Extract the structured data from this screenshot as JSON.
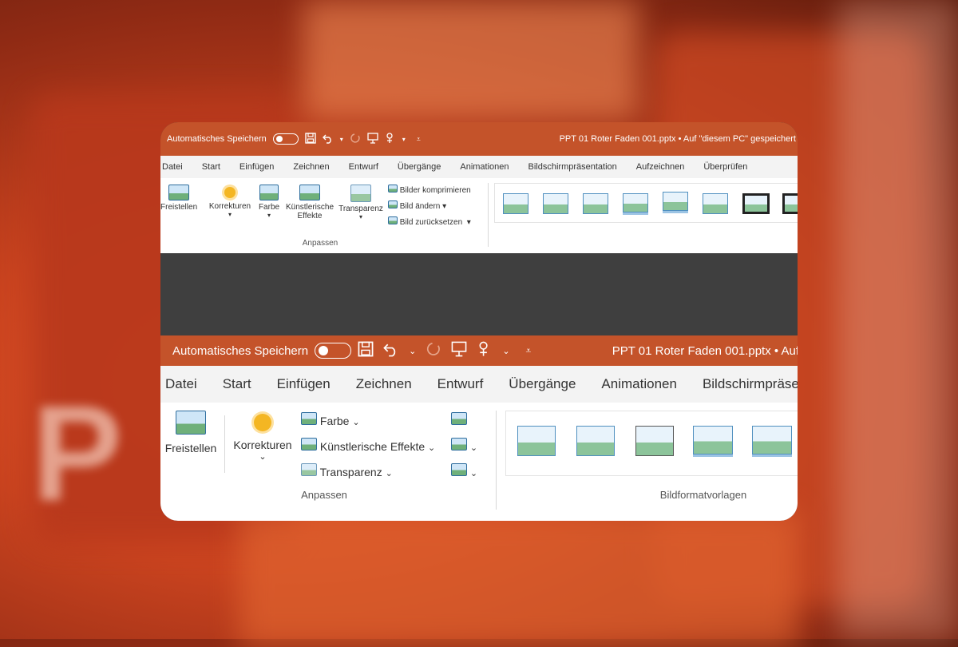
{
  "titlebar": {
    "autosave_label": "Automatisches Speichern",
    "filename_top": "PPT 01 Roter Faden 001.pptx • Auf \"diesem PC\" gespeichert",
    "filename_bottom": "PPT 01 Roter Faden 001.pptx • Auf",
    "qat_icons": [
      "save-icon",
      "undo-icon",
      "redo-icon",
      "present-icon",
      "touch-mode-icon",
      "customize-qat-icon"
    ]
  },
  "tabs_top": [
    "Datei",
    "Start",
    "Einfügen",
    "Zeichnen",
    "Entwurf",
    "Übergänge",
    "Animationen",
    "Bildschirmpräsentation",
    "Aufzeichnen",
    "Überprüfen"
  ],
  "tabs_bottom": [
    "Datei",
    "Start",
    "Einfügen",
    "Zeichnen",
    "Entwurf",
    "Übergänge",
    "Animationen",
    "Bildschirmpräse"
  ],
  "ribbon_top": {
    "freistellen": "Freistellen",
    "korrekturen": "Korrekturen",
    "farbe": "Farbe",
    "kuenstlerisch_1": "Künstlerische",
    "kuenstlerisch_2": "Effekte",
    "transparenz": "Transparenz",
    "komprimieren": "Bilder komprimieren",
    "aendern": "Bild ändern",
    "zuruecksetzen": "Bild zurücksetzen",
    "group_anpassen": "Anpassen"
  },
  "ribbon_bottom": {
    "freistellen": "Freistellen",
    "korrekturen": "Korrekturen",
    "farbe": "Farbe",
    "kuenstlerisch": "Künstlerische Effekte",
    "transparenz": "Transparenz",
    "group_anpassen": "Anpassen",
    "group_bildformat": "Bildformatvorlagen"
  },
  "colors": {
    "titlebar": "#c4532a",
    "tabs_bg": "#f3f3f3",
    "ribbon_bg": "#ffffff",
    "gap": "#3f3f3f"
  },
  "background_logo_letter": "P"
}
